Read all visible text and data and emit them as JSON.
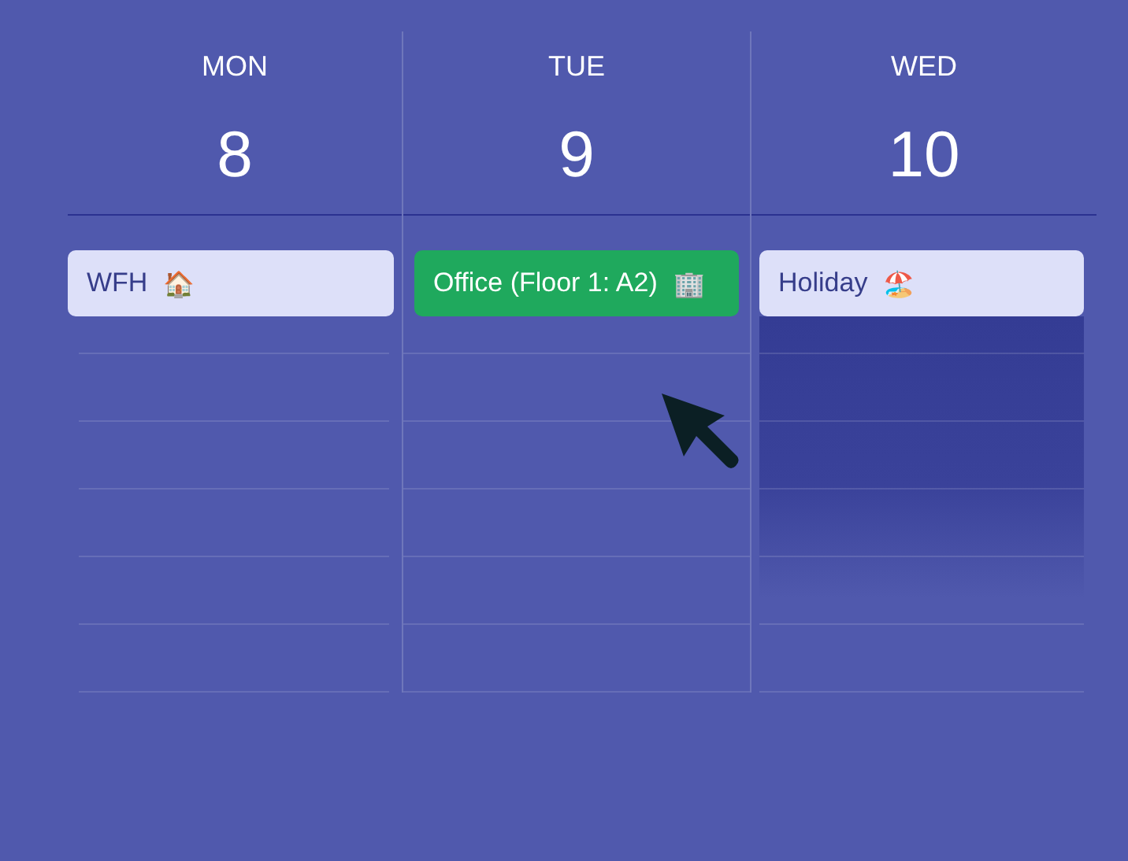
{
  "days": [
    {
      "name": "MON",
      "number": "8",
      "shaded": false,
      "entry": {
        "label": "WFH",
        "emoji": "🏠",
        "color": "#dde0f9"
      }
    },
    {
      "name": "TUE",
      "number": "9",
      "shaded": false,
      "entry": {
        "label": "Office (Floor 1: A2)",
        "emoji": "🏢",
        "color": "#1fa95d"
      }
    },
    {
      "name": "WED",
      "number": "10",
      "shaded": true,
      "entry": {
        "label": "Holiday",
        "emoji": "🏖️",
        "color": "#dde0f9"
      }
    }
  ]
}
